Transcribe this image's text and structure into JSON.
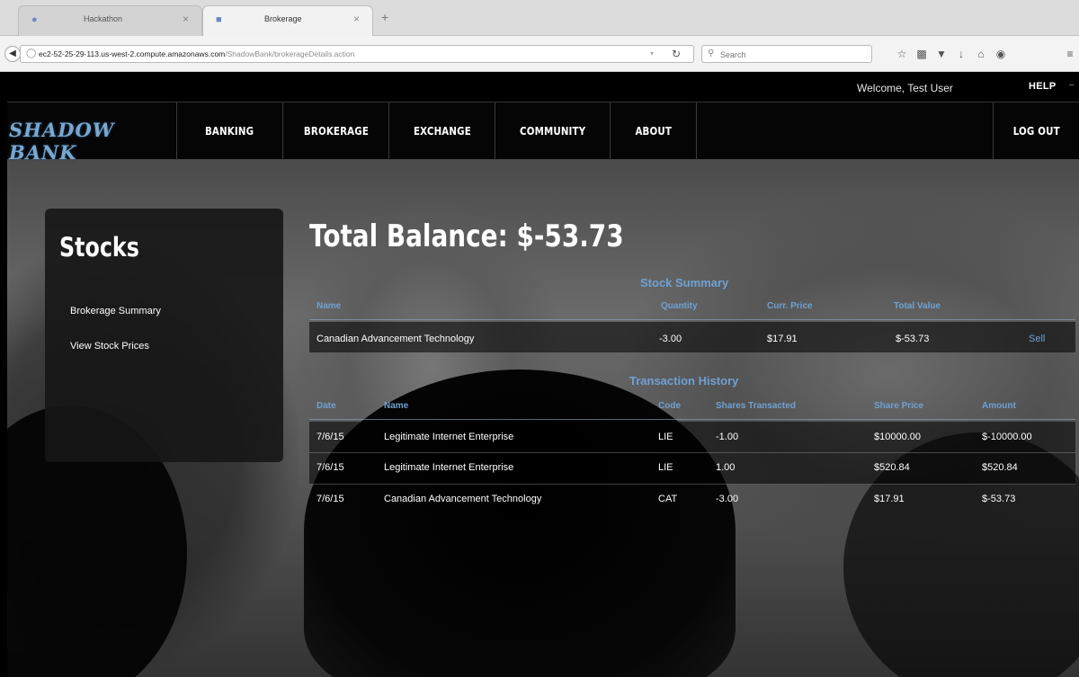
{
  "browser": {
    "tabs": [
      {
        "label": "Hackathon",
        "active": false
      },
      {
        "label": "Brokerage",
        "active": true
      }
    ],
    "new_tab": "+",
    "close": "×",
    "url_host": "ec2-52-25-29-113.us-west-2.compute.amazonaws.com",
    "url_path": "/ShadowBank/brokerageDetails.action",
    "search_placeholder": "Search"
  },
  "header": {
    "welcome": "Welcome, Test User",
    "help": "HELP"
  },
  "nav": {
    "logo": "SHADOW BANK",
    "items": [
      "BANKING",
      "BROKERAGE",
      "EXCHANGE",
      "COMMUNITY",
      "ABOUT"
    ],
    "logout": "LOG OUT"
  },
  "sidebar": {
    "title": "Stocks",
    "links": [
      "Brokerage Summary",
      "View Stock Prices"
    ]
  },
  "main": {
    "total_balance": "Total Balance: $-53.73",
    "stock_summary": {
      "title": "Stock Summary",
      "headers": [
        "Name",
        "Quantity",
        "Curr. Price",
        "Total Value"
      ],
      "rows": [
        {
          "name": "Canadian Advancement Technology",
          "quantity": "-3.00",
          "price": "$17.91",
          "total": "$-53.73",
          "action": "Sell"
        }
      ]
    },
    "transactions": {
      "title": "Transaction History",
      "headers": [
        "Date",
        "Name",
        "Code",
        "Shares Transacted",
        "Share Price",
        "Amount"
      ],
      "rows": [
        {
          "date": "7/6/15",
          "name": "Legitimate Internet Enterprise",
          "code": "LIE",
          "shares": "-1.00",
          "price": "$10000.00",
          "amount": "$-10000.00"
        },
        {
          "date": "7/6/15",
          "name": "Legitimate Internet Enterprise",
          "code": "LIE",
          "shares": "1.00",
          "price": "$520.84",
          "amount": "$520.84"
        },
        {
          "date": "7/6/15",
          "name": "Canadian Advancement Technology",
          "code": "CAT",
          "shares": "-3.00",
          "price": "$17.91",
          "amount": "$-53.73"
        }
      ]
    }
  },
  "icons": [
    "back-arrow-icon",
    "globe-icon",
    "reload-icon",
    "search-icon",
    "bookmark-star-icon",
    "reading-list-icon",
    "pocket-icon",
    "download-icon",
    "home-icon",
    "chat-icon",
    "menu-icon"
  ]
}
